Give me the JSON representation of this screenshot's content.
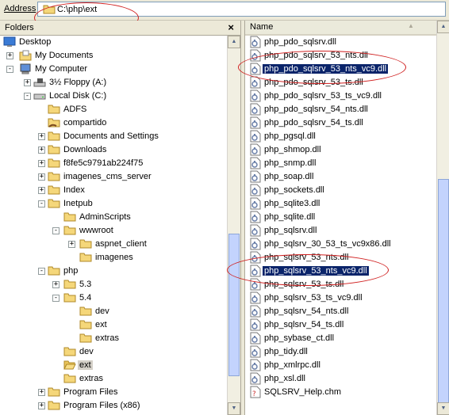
{
  "address": {
    "label": "Address",
    "value": "C:\\php\\ext"
  },
  "folders_pane": {
    "title": "Folders",
    "close": "×",
    "tree": [
      {
        "label": "Desktop",
        "level": 0,
        "icon": "desktop-icon",
        "expander": ""
      },
      {
        "label": "My Documents",
        "level": 1,
        "icon": "my-documents-icon",
        "expander": "+"
      },
      {
        "label": "My Computer",
        "level": 1,
        "icon": "my-computer-icon",
        "expander": "-"
      },
      {
        "label": "3½ Floppy (A:)",
        "level": 2,
        "icon": "floppy-drive-icon",
        "expander": "+"
      },
      {
        "label": "Local Disk (C:)",
        "level": 2,
        "icon": "hard-drive-icon",
        "expander": "-"
      },
      {
        "label": "ADFS",
        "level": 3,
        "icon": "folder-icon",
        "expander": ""
      },
      {
        "label": "compartido",
        "level": 3,
        "icon": "shared-folder-icon",
        "expander": ""
      },
      {
        "label": "Documents and Settings",
        "level": 3,
        "icon": "folder-icon",
        "expander": "+"
      },
      {
        "label": "Downloads",
        "level": 3,
        "icon": "folder-icon",
        "expander": "+"
      },
      {
        "label": "f8fe5c9791ab224f75",
        "level": 3,
        "icon": "folder-icon",
        "expander": "+"
      },
      {
        "label": "imagenes_cms_server",
        "level": 3,
        "icon": "folder-icon",
        "expander": "+"
      },
      {
        "label": "Index",
        "level": 3,
        "icon": "folder-icon",
        "expander": "+"
      },
      {
        "label": "Inetpub",
        "level": 3,
        "icon": "folder-icon",
        "expander": "-"
      },
      {
        "label": "AdminScripts",
        "level": 4,
        "icon": "folder-icon",
        "expander": ""
      },
      {
        "label": "wwwroot",
        "level": 4,
        "icon": "folder-icon",
        "expander": "-"
      },
      {
        "label": "aspnet_client",
        "level": 5,
        "icon": "folder-icon",
        "expander": "+"
      },
      {
        "label": "imagenes",
        "level": 5,
        "icon": "folder-icon",
        "expander": ""
      },
      {
        "label": "php",
        "level": 3,
        "icon": "folder-icon",
        "expander": "-"
      },
      {
        "label": "5.3",
        "level": 4,
        "icon": "folder-icon",
        "expander": "+"
      },
      {
        "label": "5.4",
        "level": 4,
        "icon": "folder-icon",
        "expander": "-"
      },
      {
        "label": "dev",
        "level": 5,
        "icon": "folder-icon",
        "expander": ""
      },
      {
        "label": "ext",
        "level": 5,
        "icon": "folder-icon",
        "expander": ""
      },
      {
        "label": "extras",
        "level": 5,
        "icon": "folder-icon",
        "expander": ""
      },
      {
        "label": "dev",
        "level": 4,
        "icon": "folder-icon",
        "expander": ""
      },
      {
        "label": "ext",
        "level": 4,
        "icon": "open-folder-icon",
        "expander": "",
        "selected": true
      },
      {
        "label": "extras",
        "level": 4,
        "icon": "folder-icon",
        "expander": ""
      },
      {
        "label": "Program Files",
        "level": 3,
        "icon": "folder-icon",
        "expander": "+"
      },
      {
        "label": "Program Files (x86)",
        "level": 3,
        "icon": "folder-icon",
        "expander": "+"
      }
    ]
  },
  "file_pane": {
    "column": "Name",
    "sort_indicator": "▲",
    "files": [
      {
        "name": "php_pdo_sqlsrv.dll",
        "icon": "dll-file-icon"
      },
      {
        "name": "php_pdo_sqlsrv_53_nts.dll",
        "icon": "dll-file-icon"
      },
      {
        "name": "php_pdo_sqlsrv_53_nts_vc9.dll",
        "icon": "dll-file-icon",
        "selected": true
      },
      {
        "name": "php_pdo_sqlsrv_53_ts.dll",
        "icon": "dll-file-icon"
      },
      {
        "name": "php_pdo_sqlsrv_53_ts_vc9.dll",
        "icon": "dll-file-icon"
      },
      {
        "name": "php_pdo_sqlsrv_54_nts.dll",
        "icon": "dll-file-icon"
      },
      {
        "name": "php_pdo_sqlsrv_54_ts.dll",
        "icon": "dll-file-icon"
      },
      {
        "name": "php_pgsql.dll",
        "icon": "dll-file-icon"
      },
      {
        "name": "php_shmop.dll",
        "icon": "dll-file-icon"
      },
      {
        "name": "php_snmp.dll",
        "icon": "dll-file-icon"
      },
      {
        "name": "php_soap.dll",
        "icon": "dll-file-icon"
      },
      {
        "name": "php_sockets.dll",
        "icon": "dll-file-icon"
      },
      {
        "name": "php_sqlite3.dll",
        "icon": "dll-file-icon"
      },
      {
        "name": "php_sqlite.dll",
        "icon": "dll-file-icon"
      },
      {
        "name": "php_sqlsrv.dll",
        "icon": "dll-file-icon"
      },
      {
        "name": "php_sqlsrv_30_53_ts_vc9x86.dll",
        "icon": "dll-file-icon"
      },
      {
        "name": "php_sqlsrv_53_nts.dll",
        "icon": "dll-file-icon"
      },
      {
        "name": "php_sqlsrv_53_nts_vc9.dll",
        "icon": "dll-file-icon",
        "selected": true
      },
      {
        "name": "php_sqlsrv_53_ts.dll",
        "icon": "dll-file-icon"
      },
      {
        "name": "php_sqlsrv_53_ts_vc9.dll",
        "icon": "dll-file-icon"
      },
      {
        "name": "php_sqlsrv_54_nts.dll",
        "icon": "dll-file-icon"
      },
      {
        "name": "php_sqlsrv_54_ts.dll",
        "icon": "dll-file-icon"
      },
      {
        "name": "php_sybase_ct.dll",
        "icon": "dll-file-icon"
      },
      {
        "name": "php_tidy.dll",
        "icon": "dll-file-icon"
      },
      {
        "name": "php_xmlrpc.dll",
        "icon": "dll-file-icon"
      },
      {
        "name": "php_xsl.dll",
        "icon": "dll-file-icon"
      },
      {
        "name": "SQLSRV_Help.chm",
        "icon": "chm-help-file-icon"
      }
    ]
  },
  "colors": {
    "selection": "#0a246a",
    "annotation": "#d02020",
    "folder": "#f5d77a"
  }
}
